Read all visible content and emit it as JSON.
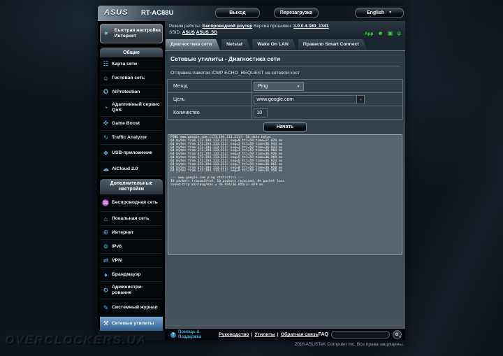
{
  "header": {
    "brand": "ASUS",
    "model": "RT-AC88U",
    "logout": "Выход",
    "reboot": "Перезагрузка",
    "language": "English"
  },
  "infobar": {
    "mode_label": "Режим работы:",
    "mode_value": "Беспроводной роутер",
    "fw_label": "Версия прошивки:",
    "fw_value": "3.0.0.4.380_1341",
    "ssid_label": "SSID:",
    "ssid_1": "ASUS",
    "ssid_2": "ASUS_5G",
    "app_badge": "App"
  },
  "tabs": [
    "Диагностика сети",
    "Netstat",
    "Wake On LAN",
    "Правило Smart Connect"
  ],
  "sidebar": {
    "quick_setup": "Быстрая настройка Интернет",
    "section_general": "Общие",
    "section_advanced": "Дополнительные настройки",
    "general_items": [
      "Карта сети",
      "Гостевая сеть",
      "AiProtection",
      "Адаптивный сервис QoS",
      "Game Boost",
      "Traffic Analyzer",
      "USB-приложение",
      "AiCloud 2.0"
    ],
    "advanced_items": [
      "Беспроводная сеть",
      "Локальная сеть",
      "Интернет",
      "IPv6",
      "VPN",
      "Брандмауэр",
      "Администри­рование",
      "Системный журнал",
      "Сетевые утилиты"
    ],
    "active_item": "Сетевые утилиты"
  },
  "content": {
    "title": "Сетевые утилиты - Диагностика сети",
    "description": "Отправка пакетов ICMP ECHO_REQUEST на сетевой хост",
    "form": {
      "method_label": "Метод",
      "method_value": "Ping",
      "target_label": "Цель",
      "target_value": "www.google.com",
      "count_label": "Количество",
      "count_value": "10"
    },
    "start_button": "Начать",
    "ping_output": [
      "PING www.google.com (173.194.113.211): 56 data bytes",
      "64 bytes from 173.194.113.211: seq=0 ttl=59 time=37.029 ms",
      "64 bytes from 173.194.113.211: seq=1 ttl=59 time=36.944 ms",
      "64 bytes from 173.194.113.211: seq=2 ttl=59 time=36.943 ms",
      "64 bytes from 173.194.113.211: seq=3 ttl=59 time=36.964 ms",
      "64 bytes from 173.194.113.211: seq=4 ttl=59 time=36.926 ms",
      "64 bytes from 173.194.113.211: seq=5 ttl=59 time=36.969 ms",
      "64 bytes from 173.194.113.211: seq=6 ttl=59 time=36.924 ms",
      "64 bytes from 173.194.113.211: seq=7 ttl=59 time=36.961 ms",
      "64 bytes from 173.194.113.211: seq=8 ttl=59 time=36.950 ms",
      "64 bytes from 173.194.113.211: seq=9 ttl=59 time=36.958 ms",
      "",
      "--- www.google.com ping statistics ---",
      "10 packets transmitted, 10 packets received, 0% packet loss",
      "round-trip min/avg/max = 36.924/36.955/37.029 ms"
    ]
  },
  "footer": {
    "help": "Помощь & Поддержка",
    "link_manual": "Руководство",
    "link_utilities": "Утилиты",
    "link_feedback": "Обратная связь",
    "sep": "|",
    "faq_label": "FAQ",
    "copyright": "2016 ASUSTeK Computer Inc. Все права защищены."
  },
  "watermark": "OVERCLOCKERS.UA",
  "icons": {
    "wand": "✶",
    "network_map": "☷",
    "guest": "☺",
    "shield_lock": "✪",
    "gauge": "◔",
    "gamepad": "✜",
    "traffic": "∿",
    "usb_app": "❖",
    "cloud": "☁",
    "wifi": "♒",
    "home": "⌂",
    "globe": "⊕",
    "globe6": "⊚",
    "vpn": "⇌",
    "firewall": "♦",
    "admin": "⚙",
    "log": "✎",
    "tools": "⚒",
    "person": "☻",
    "clients": "▣",
    "usb_plug": "ψ",
    "caret": "▼",
    "question": "?"
  },
  "colors": {
    "accent_blue": "#4fb8e4",
    "active_item": "#31618e",
    "status_green": "#3bd43b",
    "combo_arrow_red": "#e03c3c"
  }
}
